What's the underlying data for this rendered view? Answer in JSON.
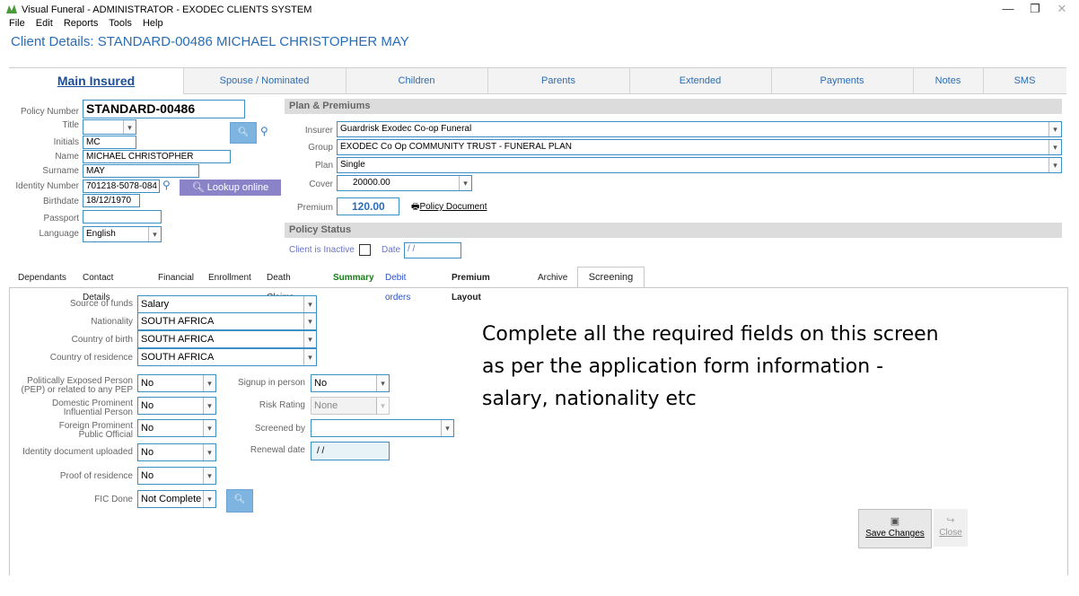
{
  "window": {
    "title": "Visual Funeral - ADMINISTRATOR - EXODEC CLIENTS SYSTEM",
    "controls": {
      "minimize": "—",
      "restore": "❐",
      "close": "✕"
    }
  },
  "menu": [
    "File",
    "Edit",
    "Reports",
    "Tools",
    "Help"
  ],
  "client_title": "Client Details: STANDARD-00486 MICHAEL CHRISTOPHER MAY",
  "tabs": [
    "Main Insured",
    "Spouse / Nominated",
    "Children",
    "Parents",
    "Extended",
    "Payments",
    "Notes",
    "SMS"
  ],
  "insured": {
    "policy_number_label": "Policy Number",
    "policy_number": "STANDARD-00486",
    "title_label": "Title",
    "title_value": "",
    "initials_label": "Initials",
    "initials": "MC",
    "name_label": "Name",
    "name": "MICHAEL CHRISTOPHER",
    "surname_label": "Surname",
    "surname": "MAY",
    "id_label": "Identity Number",
    "id_number": "701218-5078-084",
    "lookup_label": "Lookup online",
    "birthdate_label": "Birthdate",
    "birthdate": "18/12/1970",
    "passport_label": "Passport",
    "passport": "",
    "language_label": "Language",
    "language": "English"
  },
  "plan": {
    "header": "Plan & Premiums",
    "insurer_label": "Insurer",
    "insurer": "Guardrisk Exodec Co-op Funeral",
    "group_label": "Group",
    "group": "EXODEC Co Op COMMUNITY TRUST - FUNERAL PLAN",
    "plan_label": "Plan",
    "plan": "Single",
    "cover_label": "Cover",
    "cover": "20000.00",
    "premium_label": "Premium",
    "premium": "120.00",
    "policy_doc_label": "Policy Document"
  },
  "status": {
    "header": "Policy Status",
    "inactive_label": "Client is Inactive",
    "date_label": "Date",
    "date_value": "/ /"
  },
  "subtabs": [
    "Dependants",
    "Contact Details",
    "Financial",
    "Enrollment",
    "Death Claims",
    "Summary",
    "Debit orders",
    "Premium Layout",
    "Archive",
    "Screening"
  ],
  "screening": {
    "source_label": "Source of funds",
    "source": "Salary",
    "nationality_label": "Nationality",
    "nationality": "SOUTH AFRICA",
    "birth_country_label": "Country of birth",
    "birth_country": "SOUTH AFRICA",
    "residence_label": "Country of residence",
    "residence": "SOUTH AFRICA",
    "pep_label_1": "Politically Exposed Person",
    "pep_label_2": "(PEP) or related to any PEP",
    "pep": "No",
    "dpip_label_1": "Domestic Prominent",
    "dpip_label_2": "Influential Person",
    "dpip": "No",
    "fppo_label_1": "Foreign Prominent",
    "fppo_label_2": "Public Official",
    "fppo": "No",
    "id_uploaded_label": "Identity document uploaded",
    "id_uploaded": "No",
    "proof_label": "Proof of residence",
    "proof": "No",
    "fic_label": "FIC Done",
    "fic": "Not Complete",
    "signup_label": "Signup in person",
    "signup": "No",
    "risk_label": "Risk Rating",
    "risk": "None",
    "screened_label": "Screened by",
    "screened": "",
    "renewal_label": "Renewal date",
    "renewal": "/ /"
  },
  "instruction": [
    "Complete all the required fields on this screen",
    "as per the application form information -",
    "salary, nationality etc"
  ],
  "buttons": {
    "save": "Save Changes",
    "close": "Close"
  },
  "colors": {
    "accent": "#2a6db5",
    "field_border": "#3a8fc4",
    "lookup_button": "#8a83c8",
    "summary_tab": "#1a7a1a",
    "debit_tab": "#2a52c9"
  }
}
